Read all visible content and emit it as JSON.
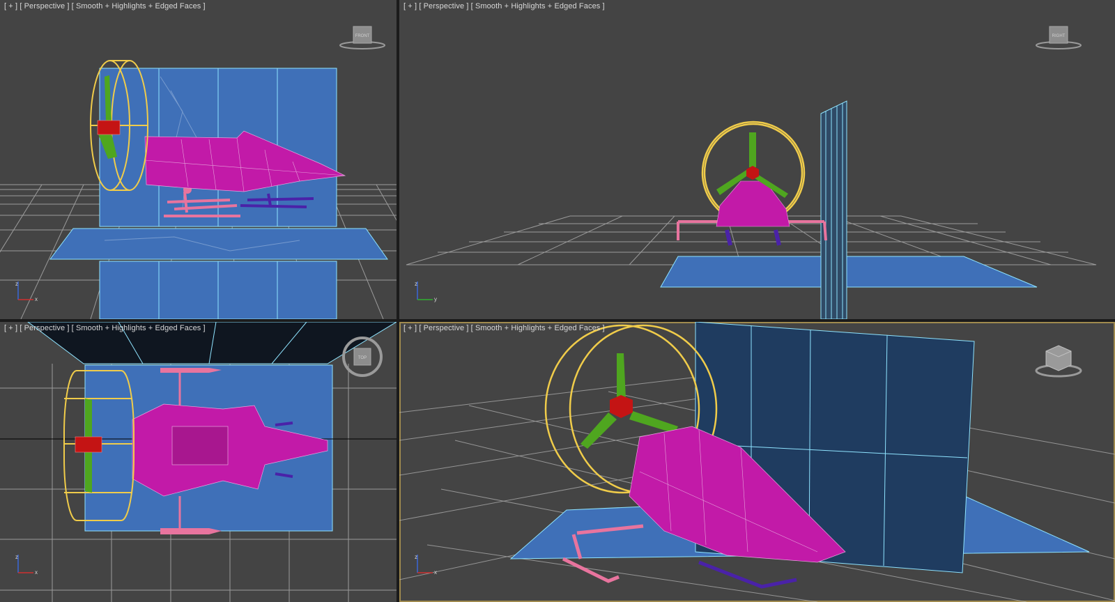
{
  "viewports": [
    {
      "id": "top-left",
      "label": {
        "plus": "[ + ]",
        "view": "[ Perspective ]",
        "shading": "[ Smooth + Highlights + Edged Faces ]"
      },
      "viewcube_face": "FRONT",
      "axes": {
        "vertical": "z",
        "horizontal": "x"
      }
    },
    {
      "id": "top-right",
      "label": {
        "plus": "[ + ]",
        "view": "[ Perspective ]",
        "shading": "[ Smooth + Highlights + Edged Faces ]"
      },
      "viewcube_face": "RIGHT",
      "axes": {
        "vertical": "z",
        "horizontal": "y"
      }
    },
    {
      "id": "bottom-left",
      "label": {
        "plus": "[ + ]",
        "view": "[ Perspective ]",
        "shading": "[ Smooth + Highlights + Edged Faces ]"
      },
      "viewcube_face": "TOP",
      "axes": {
        "vertical": "z",
        "horizontal": "x"
      }
    },
    {
      "id": "bottom-right",
      "label": {
        "plus": "[ + ]",
        "view": "[ Perspective ]",
        "shading": "[ Smooth + Highlights + Edged Faces ]"
      },
      "viewcube_face": "",
      "axes": {
        "vertical": "z",
        "horizontal": "x"
      },
      "active": true
    }
  ],
  "colors": {
    "viewport_bg": "#444444",
    "grid": "#b8b8b8",
    "blueprint": "#3f70b8",
    "blueprint_edge": "#8fe4ff",
    "hull": "#c21aa8",
    "propeller": "#4fa61f",
    "hub": "#c41414",
    "ring": "#f0cc4a",
    "skid_pink": "#e8749e",
    "skid_purple": "#4a22a8",
    "active_border": "#a08a4e"
  }
}
